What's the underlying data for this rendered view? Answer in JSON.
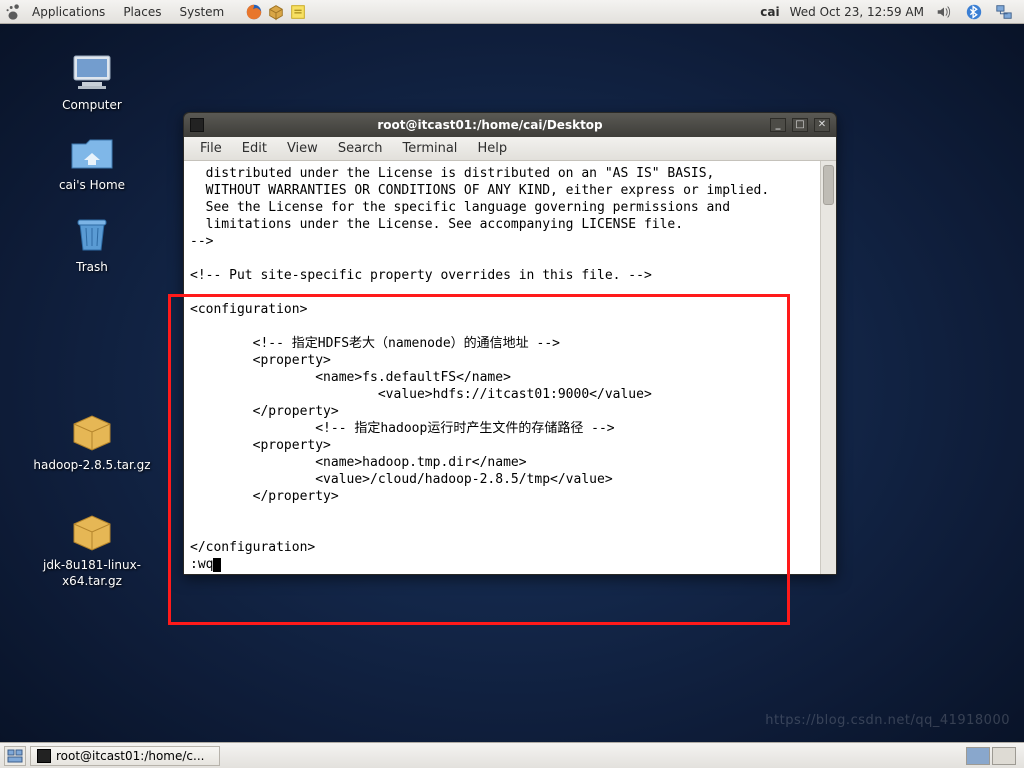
{
  "panel": {
    "menus": {
      "applications": "Applications",
      "places": "Places",
      "system": "System"
    },
    "user": "cai",
    "clock": "Wed Oct 23, 12:59 AM"
  },
  "desktop": {
    "computer": "Computer",
    "home": "cai's Home",
    "trash": "Trash",
    "hadoop": "hadoop-2.8.5.tar.gz",
    "jdk": "jdk-8u181-linux-\nx64.tar.gz"
  },
  "window": {
    "title": "root@itcast01:/home/cai/Desktop",
    "menus": {
      "file": "File",
      "edit": "Edit",
      "view": "View",
      "search": "Search",
      "terminal": "Terminal",
      "help": "Help"
    },
    "content": "  distributed under the License is distributed on an \"AS IS\" BASIS,\n  WITHOUT WARRANTIES OR CONDITIONS OF ANY KIND, either express or implied.\n  See the License for the specific language governing permissions and\n  limitations under the License. See accompanying LICENSE file.\n-->\n\n<!-- Put site-specific property overrides in this file. -->\n\n<configuration>\n\n        <!-- 指定HDFS老大（namenode）的通信地址 -->\n        <property>\n                <name>fs.defaultFS</name>\n                        <value>hdfs://itcast01:9000</value>\n        </property>\n                <!-- 指定hadoop运行时产生文件的存储路径 -->\n        <property>\n                <name>hadoop.tmp.dir</name>\n                <value>/cloud/hadoop-2.8.5/tmp</value>\n        </property>\n\n\n</configuration>\n",
    "vimcmd": ":wq"
  },
  "taskbar": {
    "task1": "root@itcast01:/home/c..."
  },
  "watermark": "https://blog.csdn.net/qq_41918000"
}
